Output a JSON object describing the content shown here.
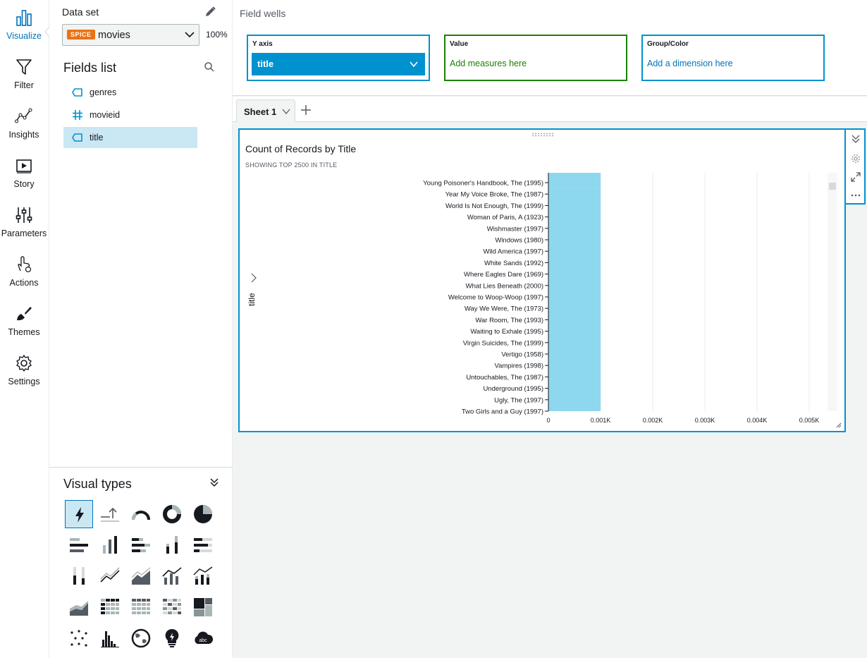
{
  "nav": {
    "items": [
      {
        "label": "Visualize",
        "icon": "bar-chart-icon"
      },
      {
        "label": "Filter",
        "icon": "funnel-icon"
      },
      {
        "label": "Insights",
        "icon": "line-insight-icon"
      },
      {
        "label": "Story",
        "icon": "play-frame-icon"
      },
      {
        "label": "Parameters",
        "icon": "sliders-icon"
      },
      {
        "label": "Actions",
        "icon": "pointer-gear-icon"
      },
      {
        "label": "Themes",
        "icon": "brush-icon"
      },
      {
        "label": "Settings",
        "icon": "gear-icon"
      }
    ],
    "active": "Visualize"
  },
  "dataset": {
    "label": "Data set",
    "badge": "SPICE",
    "name": "movies",
    "percent": "100%"
  },
  "fields": {
    "title": "Fields list",
    "items": [
      {
        "name": "genres",
        "type": "dimension",
        "selected": false
      },
      {
        "name": "movieid",
        "type": "measure",
        "selected": false
      },
      {
        "name": "title",
        "type": "dimension",
        "selected": true
      }
    ]
  },
  "visual_types": {
    "title": "Visual types",
    "items": [
      "autograph",
      "kpi",
      "gauge",
      "donut",
      "pie",
      "horizontal-bar",
      "vertical-bar",
      "horizontal-stacked-bar",
      "vertical-stacked-bar",
      "horizontal-100-bar",
      "vertical-100-bar",
      "line",
      "area-line",
      "combo-bar-line",
      "combo-stacked-line",
      "stacked-area",
      "pivot-table",
      "table",
      "heat-map",
      "tree-map",
      "scatter",
      "histogram",
      "filled-map",
      "insight",
      "word-cloud"
    ]
  },
  "wells": {
    "title": "Field wells",
    "y_axis": {
      "label": "Y axis",
      "value": "title"
    },
    "value": {
      "label": "Value",
      "placeholder": "Add measures here"
    },
    "group": {
      "label": "Group/Color",
      "placeholder": "Add a dimension here"
    }
  },
  "sheets": {
    "tabs": [
      "Sheet 1"
    ]
  },
  "visual": {
    "title": "Count of Records by Title",
    "subtitle": "SHOWING TOP 2500 IN TITLE",
    "y_axis_label": "title",
    "colors": {
      "bar": "#8dd8ef",
      "accent": "#0092cf",
      "grid": "#e9ebed"
    }
  },
  "chart_data": {
    "type": "bar",
    "orientation": "horizontal",
    "title": "Count of Records by Title",
    "subtitle": "SHOWING TOP 2500 IN TITLE",
    "ylabel": "title",
    "xlabel": "",
    "categories": [
      "Young Poisoner's Handbook, The (1995)",
      "Year My Voice Broke, The (1987)",
      "World Is Not Enough, The (1999)",
      "Woman of Paris, A (1923)",
      "Wishmaster (1997)",
      "Windows (1980)",
      "Wild America (1997)",
      "White Sands (1992)",
      "Where Eagles Dare (1969)",
      "What Lies Beneath (2000)",
      "Welcome to Woop-Woop (1997)",
      "Way We Were, The (1973)",
      "War Room, The (1993)",
      "Waiting to Exhale (1995)",
      "Virgin Suicides, The (1999)",
      "Vertigo (1958)",
      "Vampires (1998)",
      "Untouchables, The (1987)",
      "Underground (1995)",
      "Ugly, The (1997)",
      "Two Girls and a Guy (1997)"
    ],
    "values": [
      1,
      1,
      1,
      1,
      1,
      1,
      1,
      1,
      1,
      1,
      1,
      1,
      1,
      1,
      1,
      1,
      1,
      1,
      1,
      1,
      1
    ],
    "xlim": [
      0,
      5.5
    ],
    "xticks": [
      0,
      1,
      2,
      3,
      4,
      5
    ],
    "xtick_labels": [
      "0",
      "0.001K",
      "0.002K",
      "0.003K",
      "0.004K",
      "0.005K"
    ],
    "grid": true
  }
}
